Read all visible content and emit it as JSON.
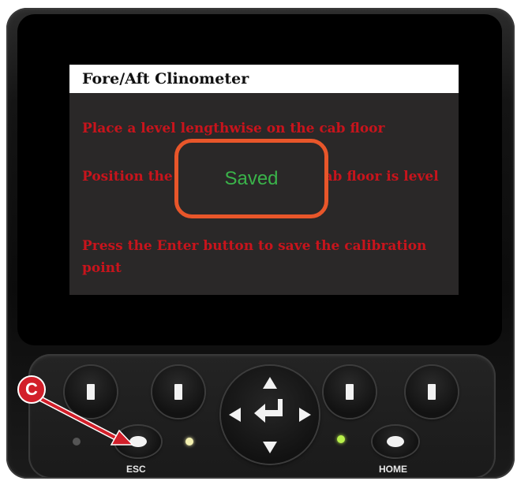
{
  "screen": {
    "title": "Fore/Aft Clinometer",
    "instructions": [
      "Place a level lengthwise on the cab floor",
      "Position the machine until the cab floor is level",
      "Press the Enter button to save the calibration point"
    ],
    "popup": {
      "text": "Saved",
      "text_color": "#3ab34a",
      "border_color": "#e8562a"
    },
    "text_color": "#c8141c"
  },
  "keypad": {
    "esc_label": "ESC",
    "home_label": "HOME",
    "leds": [
      {
        "name": "led-left",
        "color": "#555555"
      },
      {
        "name": "led-middle",
        "color": "#f3f0b0"
      },
      {
        "name": "led-right",
        "color": "#b8f04a"
      }
    ],
    "softkeys": [
      "softkey-1",
      "softkey-2",
      "softkey-3",
      "softkey-4"
    ],
    "dpad_icons": [
      "up-arrow-icon",
      "down-arrow-icon",
      "left-arrow-icon",
      "right-arrow-icon",
      "enter-icon"
    ]
  },
  "callout": {
    "label": "C",
    "color": "#d21f2a"
  }
}
